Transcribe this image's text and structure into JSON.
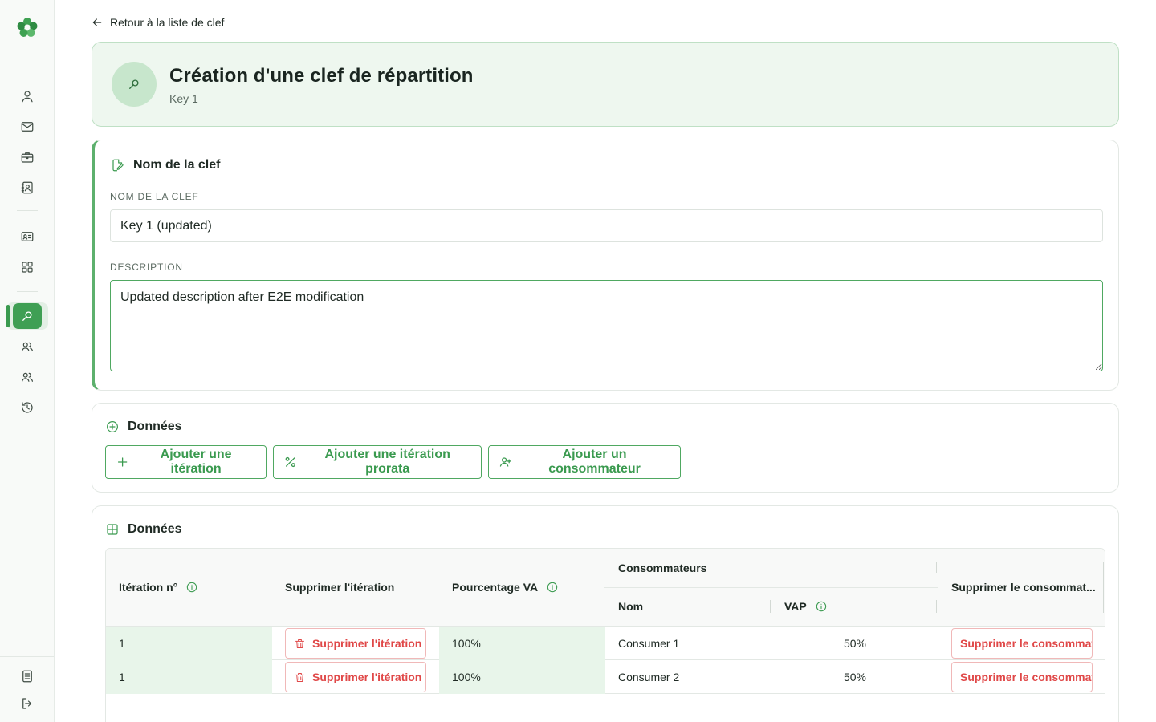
{
  "back_link": {
    "label": "Retour à la liste de clef"
  },
  "header": {
    "title": "Création d'une clef de répartition",
    "subtitle": "Key 1"
  },
  "form": {
    "section_title": "Nom de la clef",
    "name_label": "NOM DE LA CLEF",
    "name_value": "Key 1 (updated)",
    "description_label": "DESCRIPTION",
    "description_value": "Updated description after E2E modification"
  },
  "actions": {
    "section_title": "Données",
    "add_iteration": "Ajouter une itération",
    "add_prorata": "Ajouter une itération prorata",
    "add_consumer": "Ajouter un consommateur"
  },
  "table": {
    "section_title": "Données",
    "headers": {
      "iteration": "Itération n°",
      "delete_iteration": "Supprimer l'itération",
      "percentage": "Pourcentage VA",
      "consumers": "Consommateurs",
      "name": "Nom",
      "vap": "VAP",
      "delete_consumer": "Supprimer le consommat..."
    },
    "rows": [
      {
        "iteration": "1",
        "delete_iteration": "Supprimer l'itération",
        "percentage": "100%",
        "name": "Consumer 1",
        "vap": "50%",
        "delete_consumer": "Supprimer le consommateur"
      },
      {
        "iteration": "1",
        "delete_iteration": "Supprimer l'itération",
        "percentage": "100%",
        "name": "Consumer 2",
        "vap": "50%",
        "delete_consumer": "Supprimer le consommateur"
      }
    ]
  },
  "colors": {
    "accent": "#3a9a4f",
    "accent_light": "#e8f5ea",
    "danger": "#e04848",
    "header_bg": "#eef7ef"
  },
  "sidebar": {
    "icons": [
      "user-icon",
      "mail-icon",
      "briefcase-icon",
      "contact-book-icon",
      "id-card-icon",
      "grid-icon",
      "key-icon",
      "users-icon",
      "users-icon",
      "history-icon",
      "document-icon",
      "logout-icon"
    ],
    "active": "key-icon"
  }
}
